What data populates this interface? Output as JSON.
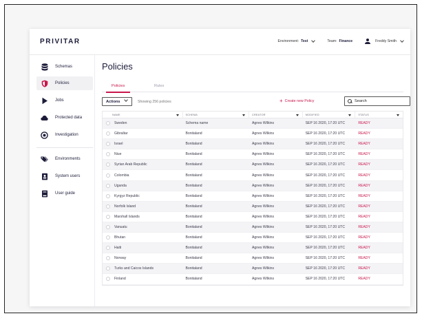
{
  "app": {
    "brand": "PRIVITAR"
  },
  "topbar": {
    "environment_label": "Environment:",
    "environment_value": "Test",
    "team_label": "Team:",
    "team_value": "Finance",
    "user_name": "Freddy Smith"
  },
  "sidebar": {
    "items": [
      {
        "label": "Schemas",
        "icon": "database-icon"
      },
      {
        "label": "Policies",
        "icon": "shield-icon"
      },
      {
        "label": "Jobs",
        "icon": "play-icon"
      },
      {
        "label": "Protected data",
        "icon": "cloud-icon"
      },
      {
        "label": "Investigation",
        "icon": "target-icon"
      },
      {
        "label": "Environments",
        "icon": "tags-icon"
      },
      {
        "label": "System users",
        "icon": "id-badge-icon"
      },
      {
        "label": "User guide",
        "icon": "book-icon"
      }
    ]
  },
  "main": {
    "title": "Policies",
    "tabs": [
      {
        "label": "Policies",
        "active": true
      },
      {
        "label": "Rules",
        "active": false
      }
    ],
    "actions_label": "Actions",
    "showing_text": "Showing 256 policies",
    "create_label": "Create new Policy",
    "search_placeholder": "Search"
  },
  "table": {
    "columns": [
      "NAME",
      "SCHEMA",
      "CREATOR",
      "MODIFIED",
      "STATUS"
    ],
    "rows": [
      {
        "name": "Sweden",
        "schema": "Schema name",
        "creator": "Agnes Wilkins",
        "modified": "SEP 16 2020, 17:20 UTC",
        "status": "READY"
      },
      {
        "name": "Gibraltar",
        "schema": "Bonitaland",
        "creator": "Agnes Wilkins",
        "modified": "SEP 16 2020, 17:20 UTC",
        "status": "READY"
      },
      {
        "name": "Israel",
        "schema": "Bonitaland",
        "creator": "Agnes Wilkins",
        "modified": "SEP 16 2020, 17:20 UTC",
        "status": "READY"
      },
      {
        "name": "Niue",
        "schema": "Bonitaland",
        "creator": "Agnes Wilkins",
        "modified": "SEP 16 2020, 17:20 UTC",
        "status": "READY"
      },
      {
        "name": "Syrian Arab Republic",
        "schema": "Bonitaland",
        "creator": "Agnes Wilkins",
        "modified": "SEP 16 2020, 17:20 UTC",
        "status": "READY"
      },
      {
        "name": "Colombia",
        "schema": "Bonitaland",
        "creator": "Agnes Wilkins",
        "modified": "SEP 16 2020, 17:20 UTC",
        "status": "READY"
      },
      {
        "name": "Uganda",
        "schema": "Bonitaland",
        "creator": "Agnes Wilkins",
        "modified": "SEP 16 2020, 17:20 UTC",
        "status": "READY"
      },
      {
        "name": "Kyrgyz Republic",
        "schema": "Bonitaland",
        "creator": "Agnes Wilkins",
        "modified": "SEP 16 2020, 17:20 UTC",
        "status": "READY"
      },
      {
        "name": "Norfolk Island",
        "schema": "Bonitaland",
        "creator": "Agnes Wilkins",
        "modified": "SEP 16 2020, 17:20 UTC",
        "status": "READY"
      },
      {
        "name": "Marshall Islands",
        "schema": "Bonitaland",
        "creator": "Agnes Wilkins",
        "modified": "SEP 16 2020, 17:20 UTC",
        "status": "READY"
      },
      {
        "name": "Vanuatu",
        "schema": "Bonitaland",
        "creator": "Agnes Wilkins",
        "modified": "SEP 16 2020, 17:20 UTC",
        "status": "READY"
      },
      {
        "name": "Bhutan",
        "schema": "Bonitaland",
        "creator": "Agnes Wilkins",
        "modified": "SEP 16 2020, 17:20 UTC",
        "status": "READY"
      },
      {
        "name": "Haiti",
        "schema": "Bonitaland",
        "creator": "Agnes Wilkins",
        "modified": "SEP 16 2020, 17:20 UTC",
        "status": "READY"
      },
      {
        "name": "Norway",
        "schema": "Bonitaland",
        "creator": "Agnes Wilkins",
        "modified": "SEP 16 2020, 17:20 UTC",
        "status": "READY"
      },
      {
        "name": "Turks and Caicos Islands",
        "schema": "Bonitaland",
        "creator": "Agnes Wilkins",
        "modified": "SEP 16 2020, 17:20 UTC",
        "status": "READY"
      },
      {
        "name": "Finland",
        "schema": "Bonitaland",
        "creator": "Agnes Wilkins",
        "modified": "SEP 16 2020, 17:20 UTC",
        "status": "READY"
      }
    ]
  },
  "colors": {
    "accent": "#c8174b",
    "text": "#1c1c3a",
    "row_alt": "#f4f4f7"
  }
}
